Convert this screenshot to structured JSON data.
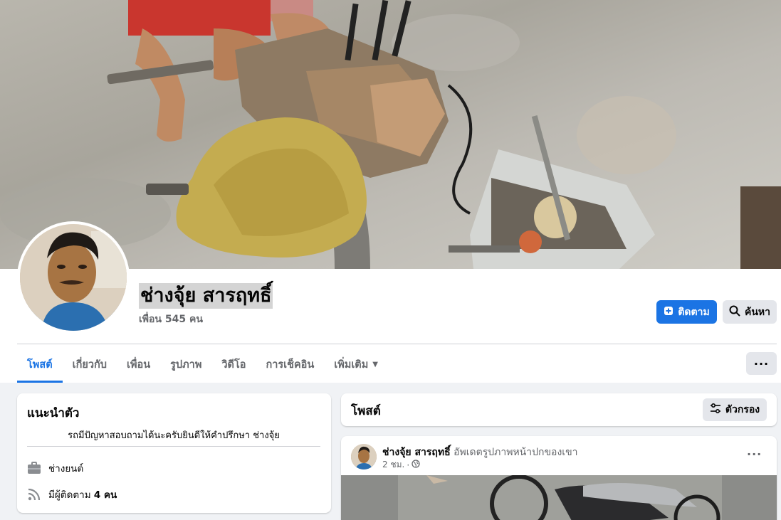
{
  "profile": {
    "name": "ช่างจุ้ย สารฤทธิ์",
    "friends": "เพื่อน 545 คน"
  },
  "actions": {
    "follow_label": "ติดตาม",
    "search_label": "ค้นหา"
  },
  "tabs": [
    {
      "label": "โพสต์",
      "active": true
    },
    {
      "label": "เกี่ยวกับ"
    },
    {
      "label": "เพื่อน"
    },
    {
      "label": "รูปภาพ"
    },
    {
      "label": "วิดีโอ"
    },
    {
      "label": "การเช็คอิน"
    },
    {
      "label": "เพิ่มเติม"
    }
  ],
  "more_label": "···",
  "intro": {
    "title": "แนะนำตัว",
    "bio": "รถมีปัญหาสอบถามได้นะครับยินดีให้คำปรึกษา ช่างจุ้ย",
    "work": "ช่างยนต์",
    "followers_prefix": "มีผู้ติดตาม ",
    "followers_count": "4 คน"
  },
  "posts": {
    "title": "โพสต์",
    "filter_label": "ตัวกรอง",
    "items": [
      {
        "author": "ช่างจุ้ย สารฤทธิ์",
        "action": "อัพเดตรูปภาพหน้าปกของเขา",
        "time": "2 ชม.",
        "more": "···"
      }
    ]
  },
  "colors": {
    "accent": "#1b74e4",
    "background": "#f0f2f5",
    "secondary_text": "#65676b",
    "button_grey": "#e4e6eb"
  },
  "icons": {
    "follow": "add-person-icon",
    "search": "search-icon",
    "filter": "filter-sliders-icon",
    "work": "briefcase-icon",
    "followers": "rss-icon",
    "privacy": "globe-icon",
    "tab_more": "caret-down-icon"
  }
}
